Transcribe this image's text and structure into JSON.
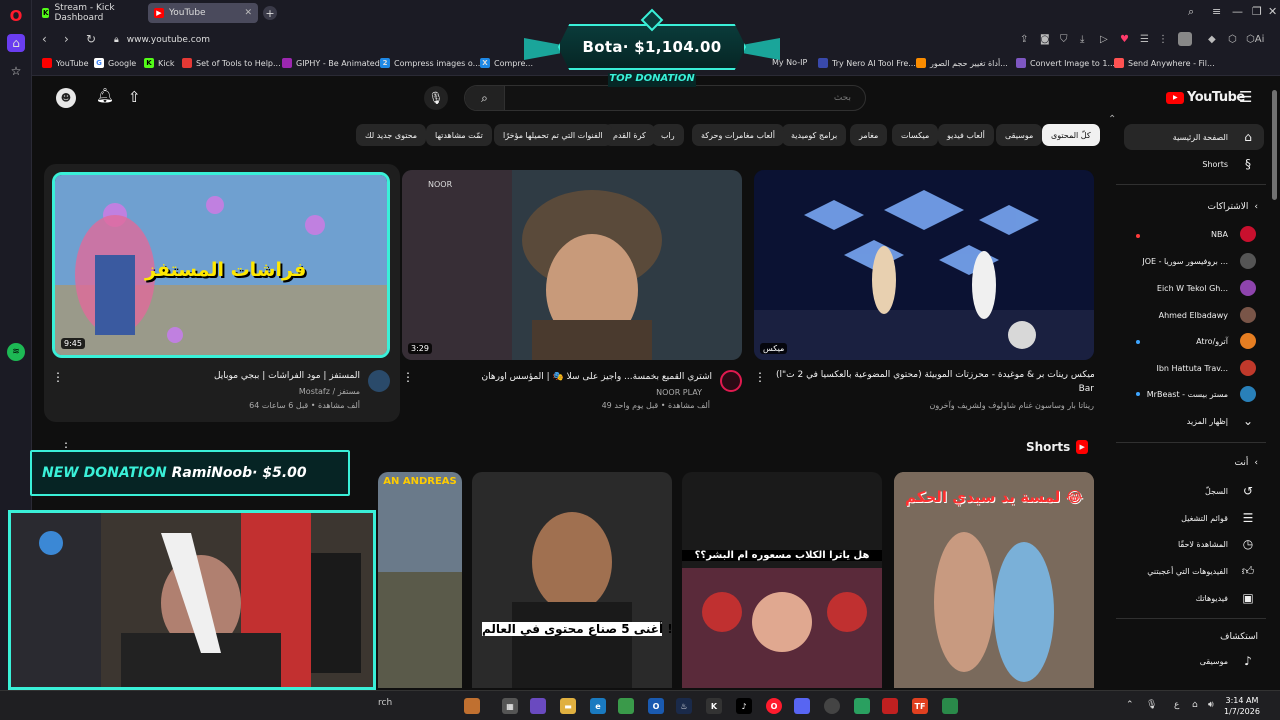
{
  "browser": {
    "tabs": [
      {
        "label": "Stream - Kick Dashboard"
      },
      {
        "label": "YouTube"
      }
    ],
    "url": "www.youtube.com",
    "ai_label": "Ai",
    "bookmarks": [
      {
        "label": "YouTube",
        "color": "#ff0000"
      },
      {
        "label": "Google",
        "color": "#4285f4"
      },
      {
        "label": "Kick",
        "color": "#53fc18"
      },
      {
        "label": "Set of Tools to Help...",
        "color": "#e53935"
      },
      {
        "label": "GIPHY - Be Animated",
        "color": "#9c27b0"
      },
      {
        "label": "Compress images o...",
        "color": "#1e88e5"
      },
      {
        "label": "Compre...",
        "color": "#1e88e5"
      },
      {
        "label": "My No-IP",
        "color": "#43a047"
      },
      {
        "label": "Try Nero AI Tool Fre...",
        "color": "#3949ab"
      },
      {
        "label": "أداة تغيير حجم الصور...",
        "color": "#fb8c00"
      },
      {
        "label": "Convert Image to 1...",
        "color": "#7e57c2"
      },
      {
        "label": "Send Anywhere - Fil...",
        "color": "#ff5252"
      }
    ]
  },
  "youtube": {
    "search_placeholder": "بحث",
    "logo_text": "YouTube",
    "chips": [
      {
        "label": "كلّ المحتوى",
        "active": true
      },
      {
        "label": "موسيقى"
      },
      {
        "label": "ألعاب فيديو"
      },
      {
        "label": "ميكسات"
      },
      {
        "label": "مغامر"
      },
      {
        "label": "برامج كوميدية"
      },
      {
        "label": "ألعاب مغامرات وحركة"
      },
      {
        "label": "راب"
      },
      {
        "label": "كرة القدم"
      },
      {
        "label": "الفنوات التي تم تحميلها مؤخرًا"
      },
      {
        "label": "تمّت مشاهدتها"
      },
      {
        "label": "محتوى جديد لك"
      }
    ],
    "sidebar": {
      "main": [
        {
          "label": "الصفحة الرئيسية",
          "icon": "home-icon"
        },
        {
          "label": "Shorts",
          "icon": "shorts-icon"
        }
      ],
      "subscriptions_heading": "الاشتراكات",
      "subscriptions": [
        {
          "label": "NBA",
          "color": "#c8102e"
        },
        {
          "label": "JOE - بروفيسور سوريا ...",
          "color": "#555"
        },
        {
          "label": "Eich W Tekol Gh...",
          "color": "#8e44ad"
        },
        {
          "label": "Ahmed Elbadawy",
          "color": "#795548"
        },
        {
          "label": "Atro/آترو",
          "color": "#e67e22"
        },
        {
          "label": "Ibn Hattuta Trav...",
          "color": "#c0392b"
        },
        {
          "label": "MrBeast - مستر بيست",
          "color": "#2980b9"
        }
      ],
      "show_more": "إظهار المزيد",
      "you_heading": "أنت",
      "you_items": [
        {
          "label": "السجلّ",
          "icon": "history-icon"
        },
        {
          "label": "قوائم التشغيل",
          "icon": "playlist-icon"
        },
        {
          "label": "المشاهدة لاحقًا",
          "icon": "clock-icon"
        },
        {
          "label": "الفيديوهات التي أعجبتني",
          "icon": "like-icon"
        },
        {
          "label": "فيديوهاتك",
          "icon": "video-icon"
        }
      ],
      "explore_heading": "استكشاف",
      "explore_items": [
        {
          "label": "موسيقى",
          "icon": "music-icon"
        }
      ]
    },
    "videos": [
      {
        "title": "ميكس رينات بر & موغيدة - محرزتات الموبيئة (محتوي المضوعية بالعكسيا في 2 ت\"ا) Rinat",
        "title2": "Bar",
        "channel": "ريناتا بار وساسون غنام شاولوف ولشريف وآخرون",
        "meta": "",
        "duration": "ميكس",
        "thumb_color": "#0a1030"
      },
      {
        "title": "اشتري القميع بخمسة... وأجيز على سلّا 🎭 | المؤسس أورهان",
        "channel": "NOOR PLAY",
        "meta": "49 ألف مشاهدة • قبل يوم واحد",
        "duration": "3:29",
        "thumb_color": "#3a2e28"
      },
      {
        "title": "المستفز | مود الفراشات | ببجي موبايل",
        "channel": "Mostafz / مستفز",
        "meta": "64 ألف مشاهدة • قبل 6 ساعات",
        "duration": "9:45",
        "thumb_text": "فراشات المستفز",
        "thumb_color": "#4a7bb0"
      }
    ],
    "shorts_heading": "Shorts",
    "shorts": [
      {
        "caption": "لمسة يد سيدي الحكم 😂",
        "color": "#6b5a4a"
      },
      {
        "caption": "هل ياترا الكلاب مسعوره ام البشر؟؟",
        "color": "#4a2a3a"
      },
      {
        "caption": "أغنى 5 صناع محتوى في العالم !!",
        "color": "#2a2a2a"
      },
      {
        "caption": "AN ANDREAS",
        "color": "#5a6a7a"
      }
    ]
  },
  "overlays": {
    "top_donation_amount": "Bota· $1,104.00",
    "top_donation_label": "TOP DONATION",
    "new_donation_prefix": "NEW DONATION",
    "new_donation_text": "RamiNoob· $5.00"
  },
  "taskbar": {
    "search_placeholder": "rch",
    "time": "3:14 AM",
    "date": "1/7/2026"
  }
}
